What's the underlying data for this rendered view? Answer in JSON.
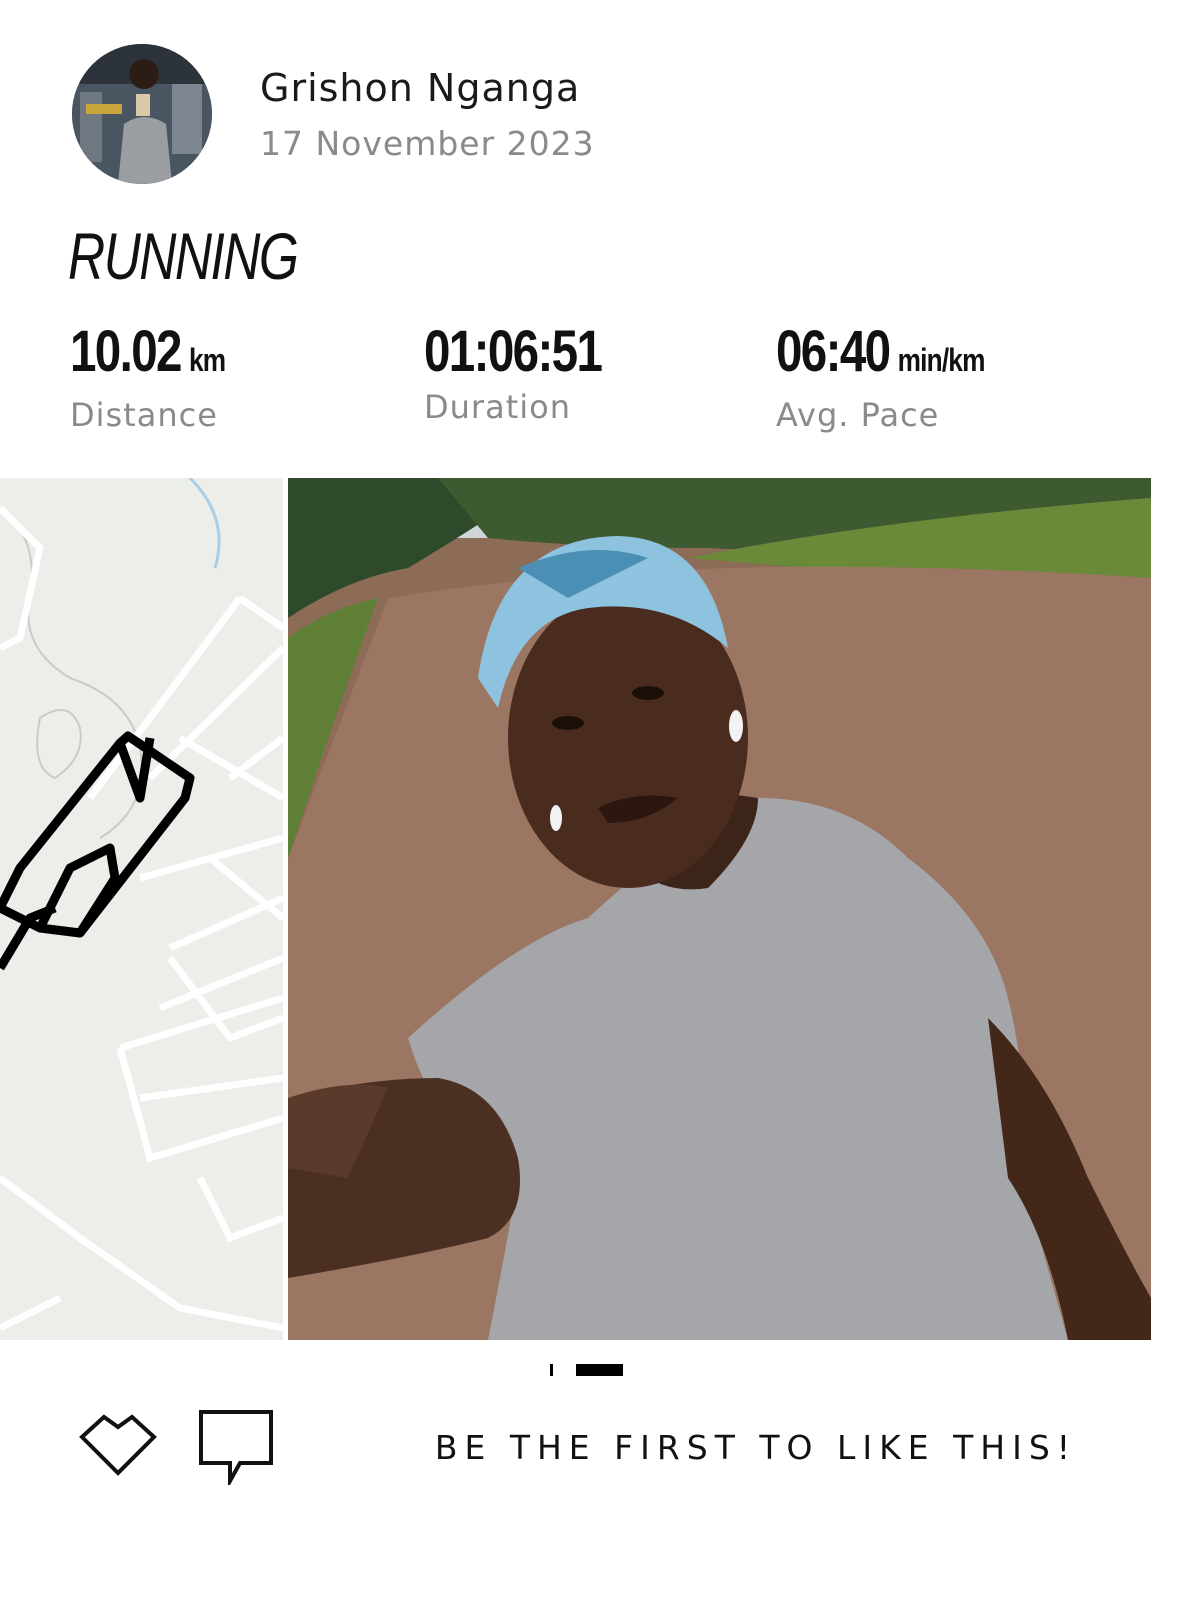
{
  "user": {
    "name": "Grishon Nganga",
    "date": "17 November 2023"
  },
  "activity": {
    "type": "RUNNING"
  },
  "stats": [
    {
      "value": "10.02",
      "unit": "km",
      "label": "Distance"
    },
    {
      "value": "01:06:51",
      "unit": "",
      "label": "Duration"
    },
    {
      "value": "06:40",
      "unit": "min/km",
      "label": "Avg. Pace"
    }
  ],
  "pager": {
    "count": 2,
    "active": 2
  },
  "social": {
    "like_prompt": "BE THE FIRST TO LIKE THIS!"
  },
  "icons": {
    "like": "heart-outline-icon",
    "comment": "speech-bubble-icon"
  },
  "colors": {
    "map_bg": "#eceeea",
    "route": "#000000",
    "label_gray": "#8a8a8a"
  }
}
